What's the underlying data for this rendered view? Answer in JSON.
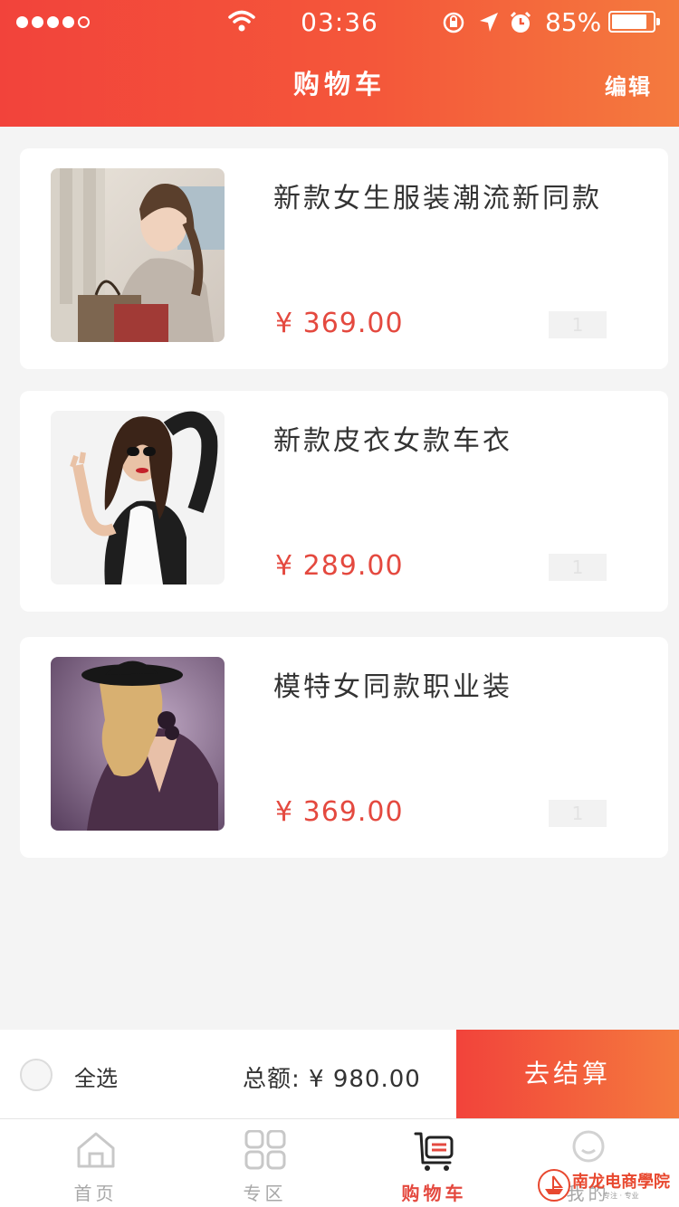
{
  "status_bar": {
    "time": "03:36",
    "battery": "85%",
    "signal_dots_filled": 4
  },
  "header": {
    "title": "购物车",
    "edit_label": "编辑"
  },
  "items": [
    {
      "name": "新款女生服装潮流新同款",
      "price": "¥ 369.00",
      "quantity": "1"
    },
    {
      "name": "新款皮衣女款车衣",
      "price": "¥ 289.00",
      "quantity": "1"
    },
    {
      "name": "模特女同款职业装",
      "price": "¥ 369.00",
      "quantity": "1"
    }
  ],
  "checkout": {
    "select_all_label": "全选",
    "total_label": "总额:",
    "total_value": "¥ 980.00",
    "pay_label": "去结算"
  },
  "tabs": [
    {
      "label": "首页",
      "icon": "home-icon",
      "active": false
    },
    {
      "label": "专区",
      "icon": "grid-icon",
      "active": false
    },
    {
      "label": "购物车",
      "icon": "cart-icon",
      "active": true
    },
    {
      "label": "我的",
      "icon": "user-icon",
      "active": false
    }
  ],
  "watermark": {
    "text": "南龙电商學院",
    "subtext": "专注 · 专业"
  },
  "colors": {
    "accent": "#f2433b",
    "accent_end": "#f47a3e",
    "price": "#e4493f"
  }
}
